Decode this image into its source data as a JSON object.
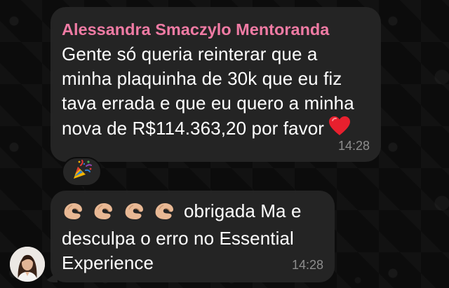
{
  "chat": {
    "messages": [
      {
        "sender": "Alessandra Smaczylo Mentoranda",
        "lines": [
          "Gente só queria reinterar que a",
          "minha plaquinha de 30k que eu fiz",
          "tava errada e que eu quero a minha",
          "nova de R$114.363,20 por favor"
        ],
        "trailing_emoji": "red-heart",
        "time": "14:28",
        "reaction_emoji": "party-popper"
      },
      {
        "prefix_emojis": [
          "pinching-hand",
          "pinching-hand",
          "pinching-hand",
          "pinching-hand"
        ],
        "lines": [
          "obrigada Ma e",
          "desculpa o erro no Essential",
          "Experience"
        ],
        "time": "14:28"
      }
    ]
  },
  "colors": {
    "bubble": "#242424",
    "sender_name": "#f07ba4",
    "text": "#ffffff",
    "timestamp": "#8d8d8d",
    "background": "#0c0c0c"
  }
}
